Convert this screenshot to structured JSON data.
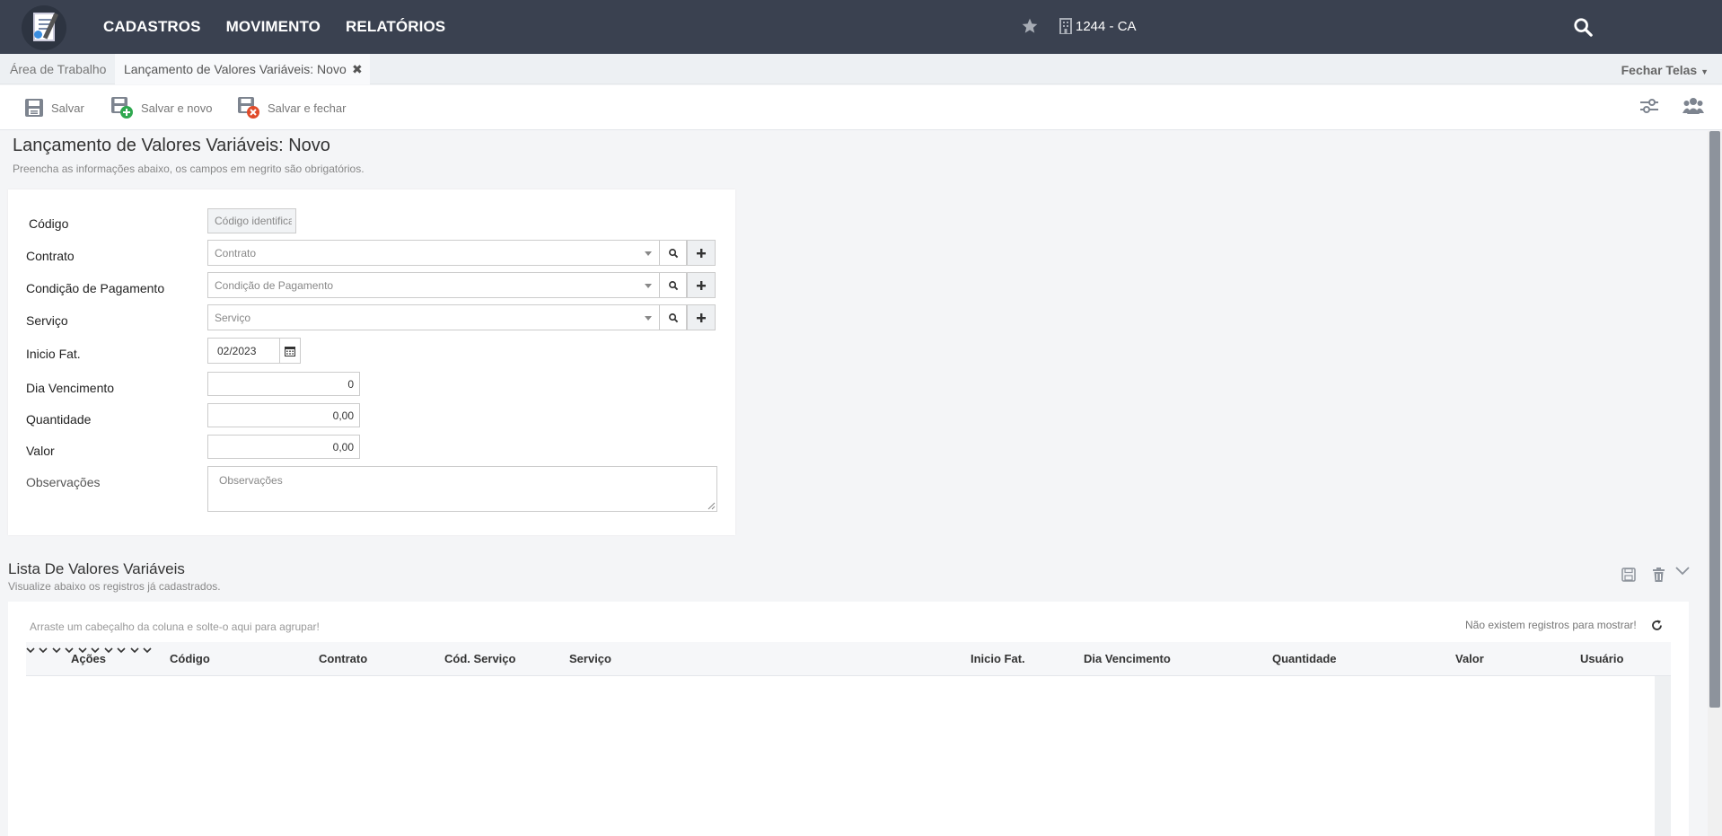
{
  "topbar": {
    "menu": [
      {
        "label": "CADASTROS"
      },
      {
        "label": "MOVIMENTO"
      },
      {
        "label": "RELATÓRIOS"
      }
    ],
    "company": "1244 - CA"
  },
  "tabs": {
    "items": [
      {
        "label": "Área de Trabalho"
      },
      {
        "label": "Lançamento de Valores Variáveis: Novo"
      }
    ],
    "close_all": "Fechar Telas"
  },
  "toolbar": {
    "save": "Salvar",
    "save_new": "Salvar e novo",
    "save_close": "Salvar e fechar"
  },
  "page": {
    "title": "Lançamento de Valores Variáveis: Novo",
    "subtitle": "Preencha as informações abaixo, os campos em negrito são obrigatórios."
  },
  "form": {
    "codigo": {
      "label": "Código",
      "placeholder": "Código identificador"
    },
    "contrato": {
      "label": "Contrato",
      "placeholder": "Contrato"
    },
    "condicao": {
      "label": "Condição de Pagamento",
      "placeholder": "Condição de Pagamento"
    },
    "servico": {
      "label": "Serviço",
      "placeholder": "Serviço"
    },
    "inicio_fat": {
      "label": "Inicio Fat.",
      "value": "02/2023"
    },
    "dia_vencimento": {
      "label": "Dia Vencimento",
      "value": "0"
    },
    "quantidade": {
      "label": "Quantidade",
      "value": "0,00"
    },
    "valor": {
      "label": "Valor",
      "value": "0,00"
    },
    "observacoes": {
      "label": "Observações",
      "placeholder": "Observações"
    }
  },
  "list": {
    "title": "Lista De Valores Variáveis",
    "subtitle": "Visualize abaixo os registros já cadastrados.",
    "group_hint": "Arraste um cabeçalho da coluna e solte-o aqui para agrupar!",
    "empty": "Não existem registros para mostrar!",
    "columns": [
      "Ações",
      "Código",
      "Contrato",
      "Cód. Serviço",
      "Serviço",
      "Inicio Fat.",
      "Dia Vencimento",
      "Quantidade",
      "Valor",
      "Usuário"
    ]
  },
  "colors": {
    "topbar": "#3a4150",
    "accent_green": "#2fa84f",
    "accent_red": "#e04b2a"
  }
}
